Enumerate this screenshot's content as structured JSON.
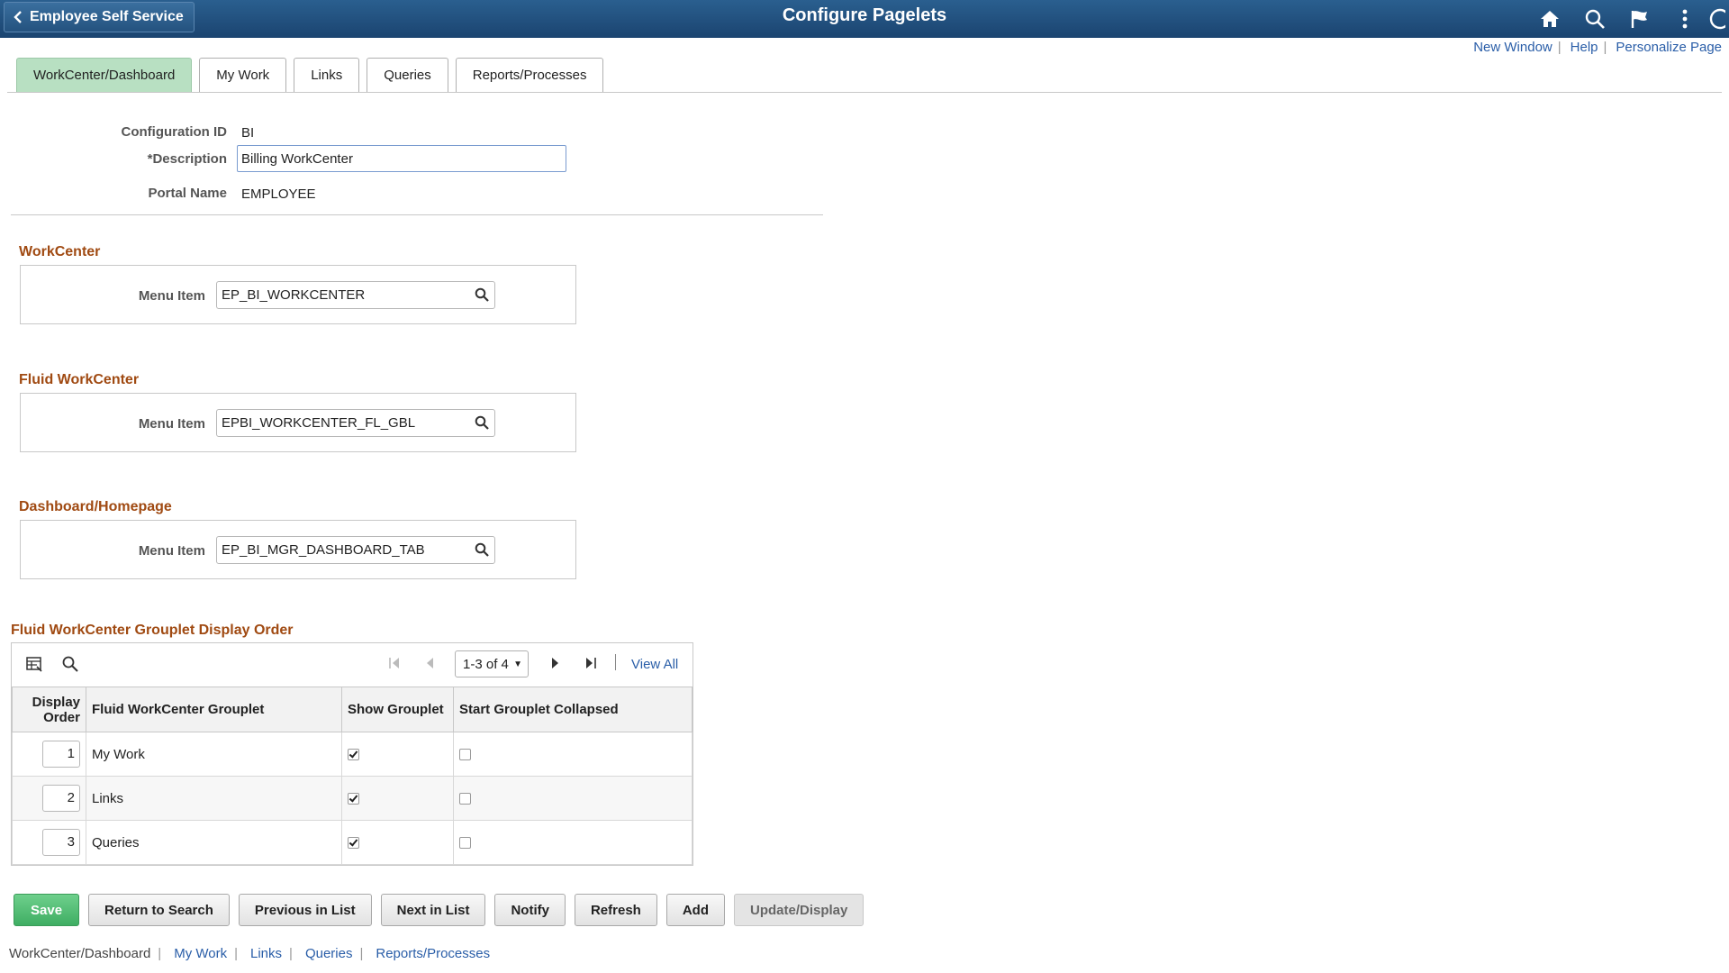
{
  "banner": {
    "back_label": "Employee Self Service",
    "title": "Configure Pagelets",
    "icons": [
      "home-icon",
      "search-icon",
      "flag-icon",
      "more-vertical-icon",
      "navbar-icon"
    ]
  },
  "top_links": [
    "New Window",
    "Help",
    "Personalize Page"
  ],
  "tabs": [
    {
      "label": "WorkCenter/Dashboard",
      "active": true
    },
    {
      "label": "My Work",
      "active": false
    },
    {
      "label": "Links",
      "active": false
    },
    {
      "label": "Queries",
      "active": false
    },
    {
      "label": "Reports/Processes",
      "active": false
    }
  ],
  "header": {
    "config_id_label": "Configuration ID",
    "config_id_value": "BI",
    "description_label": "*Description",
    "description_value": "Billing WorkCenter",
    "portal_label": "Portal Name",
    "portal_value": "EMPLOYEE"
  },
  "sections": [
    {
      "title": "WorkCenter",
      "menu_label": "Menu Item",
      "menu_value": "EP_BI_WORKCENTER"
    },
    {
      "title": "Fluid WorkCenter",
      "menu_label": "Menu Item",
      "menu_value": "EPBI_WORKCENTER_FL_GBL"
    },
    {
      "title": "Dashboard/Homepage",
      "menu_label": "Menu Item",
      "menu_value": "EP_BI_MGR_DASHBOARD_TAB"
    }
  ],
  "grid": {
    "title": "Fluid WorkCenter Grouplet Display Order",
    "pager": "1-3 of 4",
    "view_all": "View All",
    "columns": [
      "Display Order",
      "Fluid WorkCenter Grouplet",
      "Show Grouplet",
      "Start Grouplet Collapsed"
    ],
    "rows": [
      {
        "order": "1",
        "grouplet": "My Work",
        "show": true,
        "collapsed": false
      },
      {
        "order": "2",
        "grouplet": "Links",
        "show": true,
        "collapsed": false
      },
      {
        "order": "3",
        "grouplet": "Queries",
        "show": true,
        "collapsed": false
      }
    ]
  },
  "buttons": {
    "save": "Save",
    "return": "Return to Search",
    "previous": "Previous in List",
    "next": "Next in List",
    "notify": "Notify",
    "refresh": "Refresh",
    "add": "Add",
    "update": "Update/Display"
  },
  "bottom_links": [
    "WorkCenter/Dashboard",
    "My Work",
    "Links",
    "Queries",
    "Reports/Processes"
  ],
  "colors": {
    "banner": "#1f4d7a",
    "active_tab": "#b8e0c2",
    "section_title": "#a04a12",
    "link": "#2a5ea8",
    "save": "#4cbb6e"
  }
}
